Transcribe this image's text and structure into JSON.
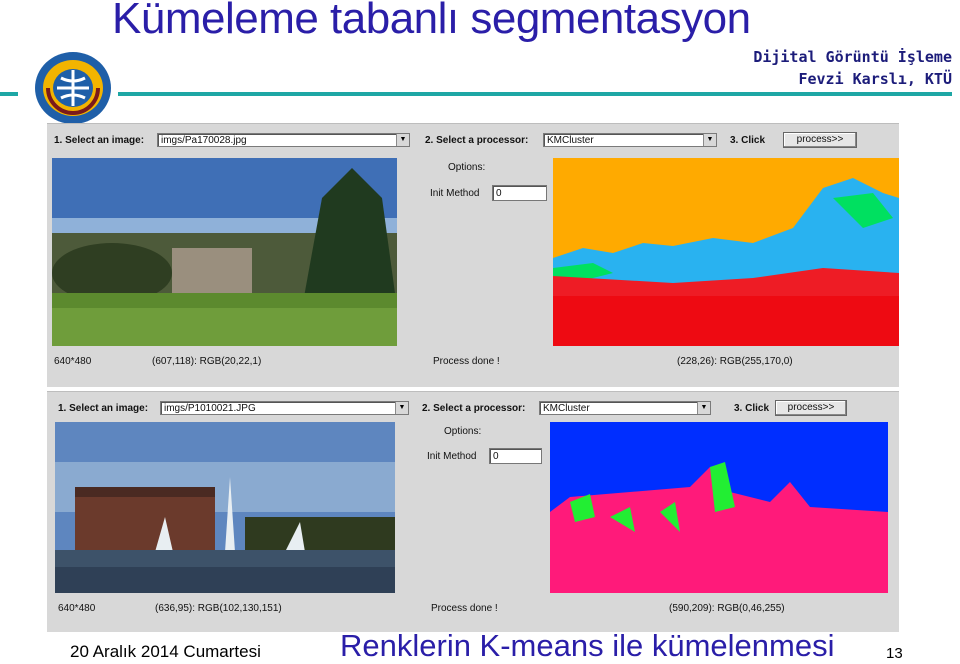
{
  "slide": {
    "title": "Kümeleme tabanlı segmentasyon",
    "course": "Dijital Görüntü İşleme",
    "author": "Fevzi Karslı, KTÜ",
    "footer_date": "20 Aralık 2014 Cumartesi",
    "footer_caption": "Renklerin K-means ile kümelenmesi",
    "page_number": "13",
    "accent_color": "#1ea7a5",
    "title_color": "#2a1ea8"
  },
  "panels": [
    {
      "select_image_label": "1. Select an image:",
      "image_value": "imgs/Pa170028.jpg",
      "select_processor_label": "2. Select a processor:",
      "processor_value": "KMCluster",
      "click_label": "3. Click",
      "process_button": "process>>",
      "options_label": "Options:",
      "init_method_label": "Init Method",
      "init_method_value": "0",
      "size_text": "640*480",
      "left_pixel_info": "(607,118): RGB(20,22,1)",
      "status_text": "Process done !",
      "right_pixel_info": "(228,26): RGB(255,170,0)"
    },
    {
      "select_image_label": "1. Select an image:",
      "image_value": "imgs/P1010021.JPG",
      "select_processor_label": "2. Select a processor:",
      "processor_value": "KMCluster",
      "click_label": "3. Click",
      "process_button": "process>>",
      "options_label": "Options:",
      "init_method_label": "Init Method",
      "init_method_value": "0",
      "size_text": "640*480",
      "left_pixel_info": "(636,95): RGB(102,130,151)",
      "status_text": "Process done !",
      "right_pixel_info": "(590,209): RGB(0,46,255)"
    }
  ]
}
